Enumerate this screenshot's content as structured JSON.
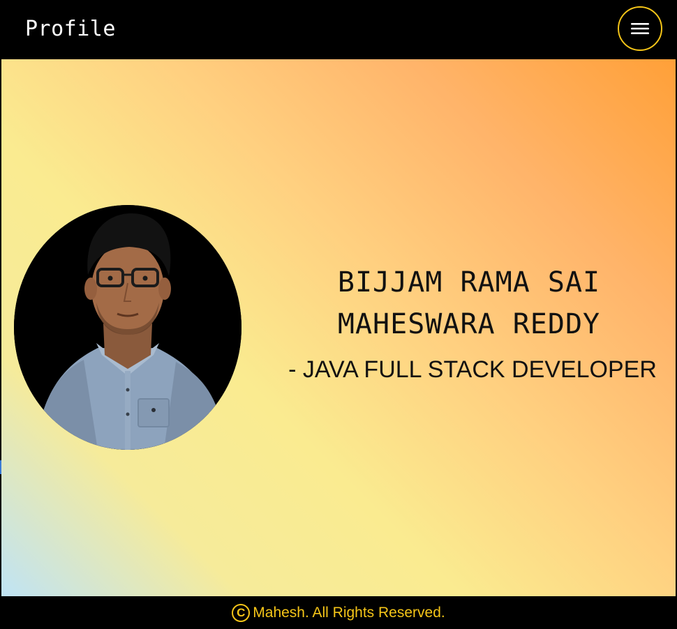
{
  "header": {
    "brand": "Profile",
    "menu_icon": "hamburger-menu-icon"
  },
  "hero": {
    "name_line1": "BIJJAM RAMA SAI",
    "name_line2": "MAHESWARA REDDY",
    "role": "- JAVA FULL STACK DEVELOPER",
    "photo_icon": "profile-photo"
  },
  "footer": {
    "copyright_symbol": "C",
    "text": "Mahesh. All Rights Reserved."
  },
  "colors": {
    "accent": "#f5c518",
    "header_bg": "#000000",
    "gradient": [
      "#bfe3f5",
      "#faeb90",
      "#ffd080",
      "#ffa038"
    ]
  }
}
